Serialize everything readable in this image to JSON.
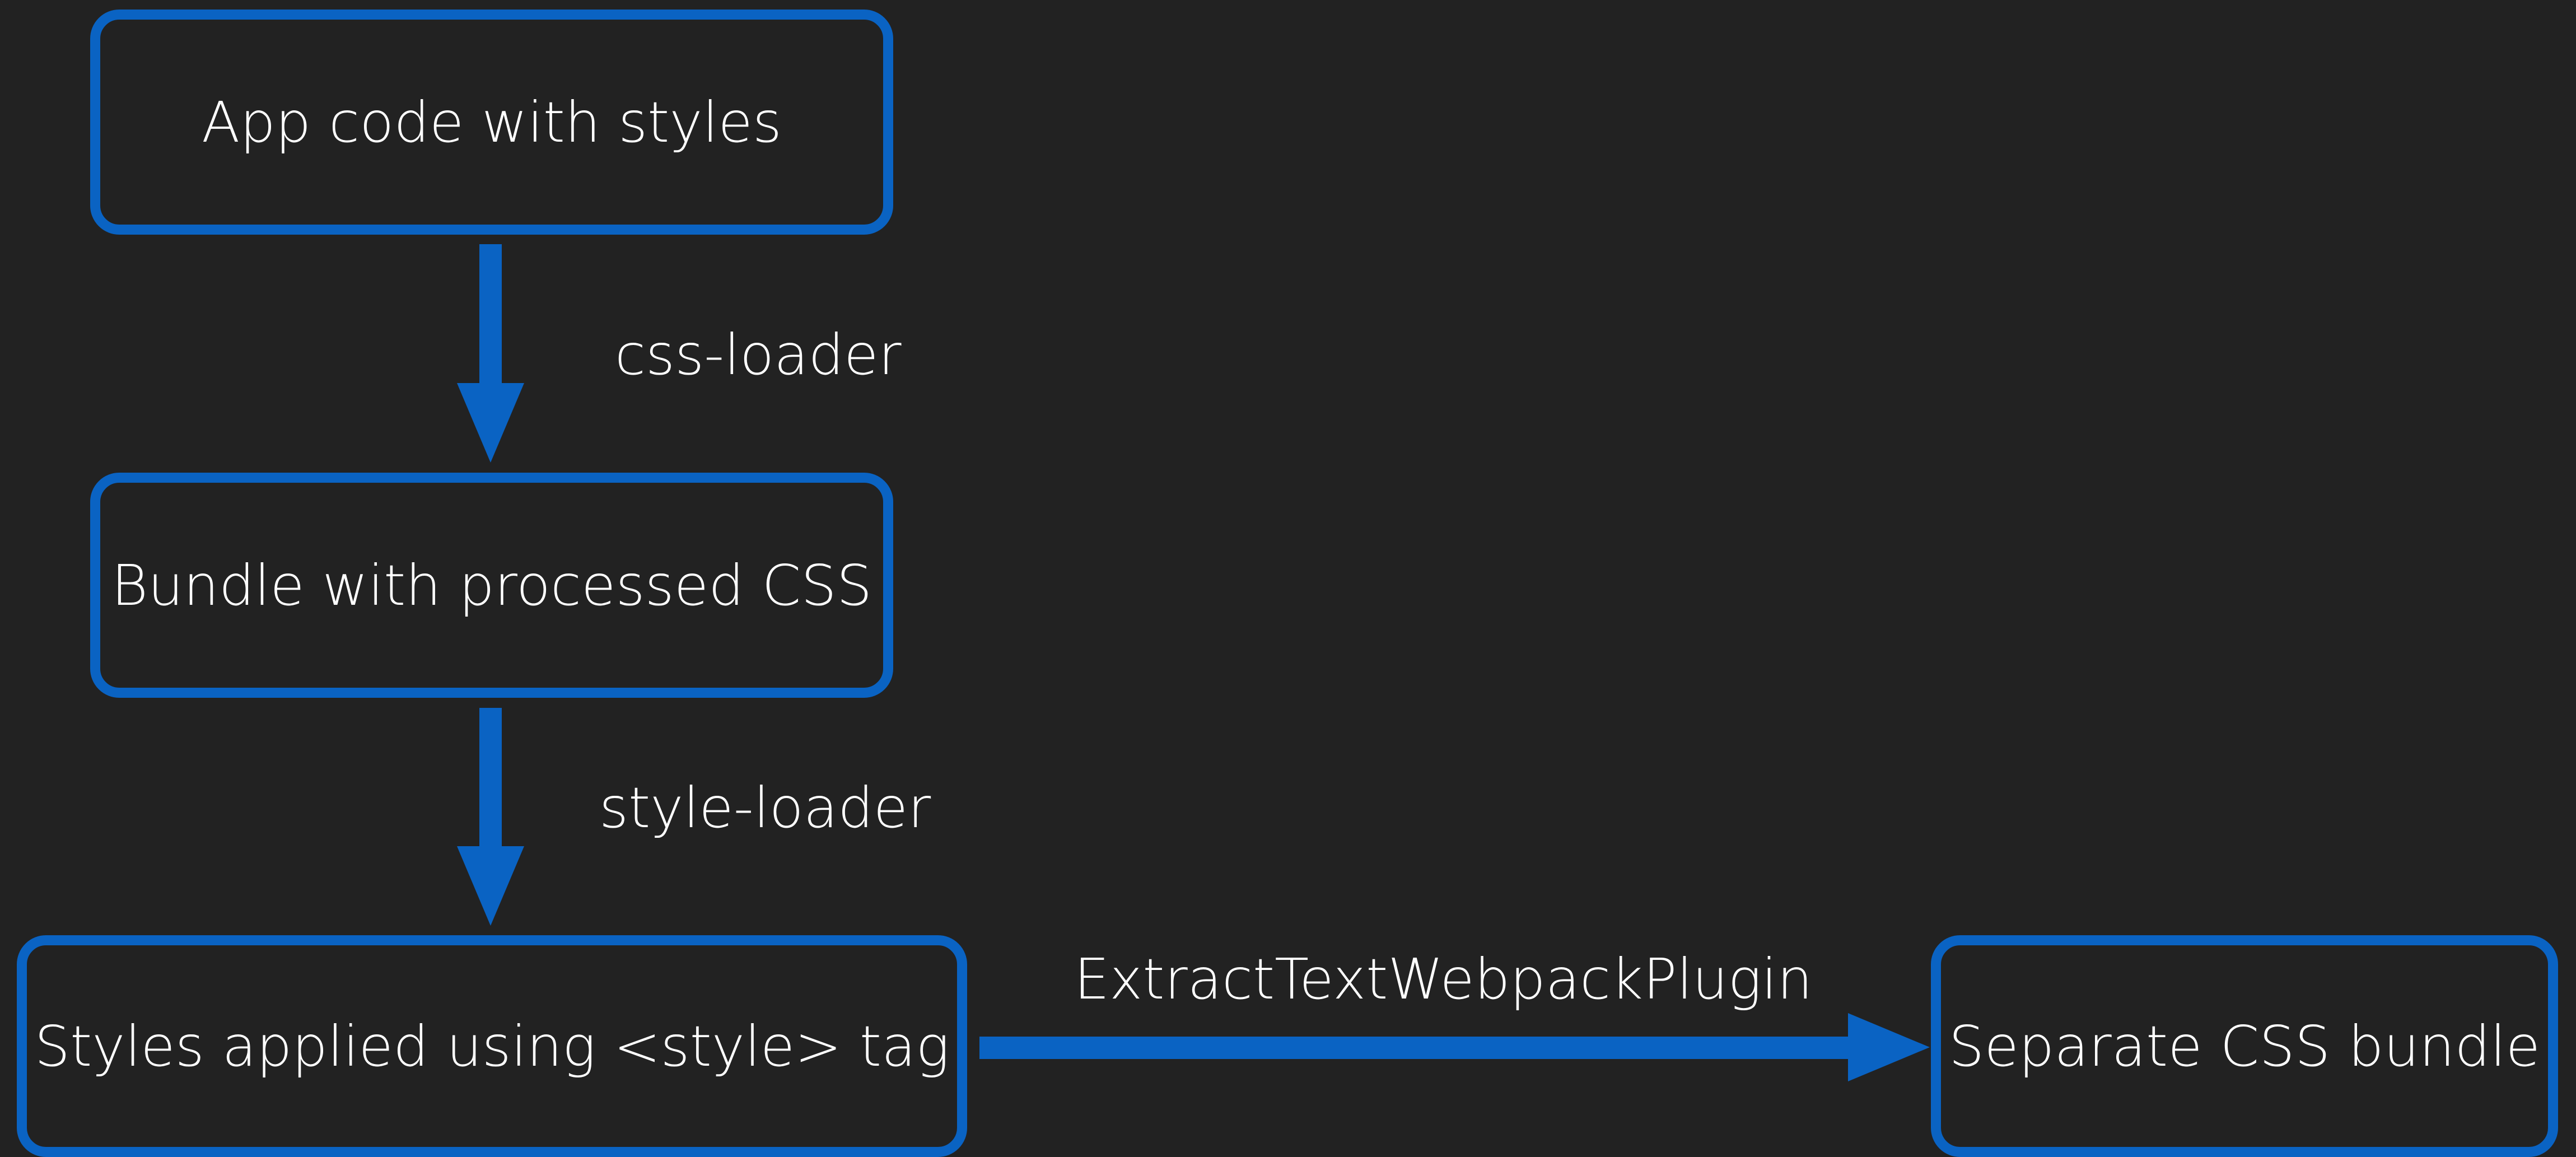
{
  "colors": {
    "background": "#222222",
    "accent": "#0a63c3",
    "text": "#ffffff"
  },
  "nodes": {
    "app_code": "App code with styles",
    "bundle": "Bundle with processed CSS",
    "styles_applied": "Styles applied using <style> tag",
    "separate_bundle": "Separate CSS bundle"
  },
  "edges": {
    "css_loader": "css-loader",
    "style_loader": "style-loader",
    "extract_plugin": "ExtractTextWebpackPlugin"
  }
}
